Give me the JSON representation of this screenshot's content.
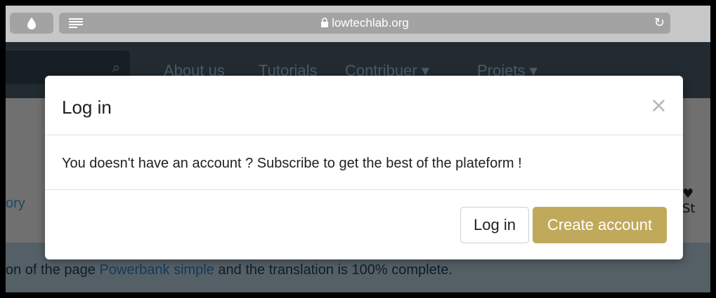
{
  "browser": {
    "url": "lowtechlab.org",
    "lock_icon": "lock-icon",
    "reload_icon": "reload-icon",
    "drop_icon": "droplet-icon",
    "reader_icon": "reader-icon"
  },
  "site_nav": {
    "items": [
      "About us",
      "Tutorials",
      "Contribuer ▾",
      "Projets ▾"
    ]
  },
  "page": {
    "history_label": "ory",
    "star_label": "♥ St",
    "translation_prefix": "on of the page ",
    "translation_link": "Powerbank simple",
    "translation_suffix": " and the translation is 100% complete."
  },
  "modal": {
    "title": "Log in",
    "close": "×",
    "message": "You doesn't have an account ? Subscribe to get the best of the plateform !",
    "login_button": "Log in",
    "create_button": "Create account"
  },
  "colors": {
    "accent": "#c0a95b",
    "nav_bg": "#222b31"
  }
}
